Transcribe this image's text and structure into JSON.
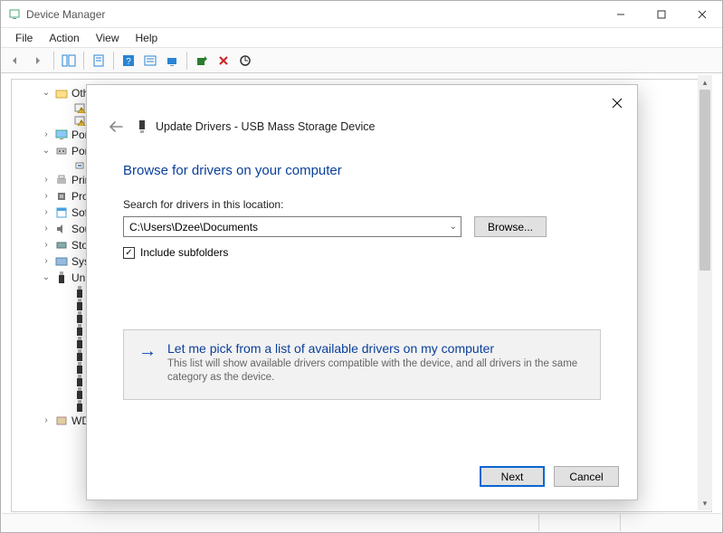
{
  "window": {
    "title": "Device Manager"
  },
  "menubar": {
    "items": [
      "File",
      "Action",
      "View",
      "Help"
    ]
  },
  "tree": {
    "items": [
      {
        "chev": "v",
        "label": "Oth",
        "indent": 1
      },
      {
        "label": "",
        "indent": 2,
        "warn": true
      },
      {
        "label": "",
        "indent": 2,
        "warn": true
      },
      {
        "chev": ">",
        "label": "Por",
        "indent": 1
      },
      {
        "chev": "v",
        "label": "Por",
        "indent": 1
      },
      {
        "label": "",
        "indent": 2
      },
      {
        "chev": ">",
        "label": "Prin",
        "indent": 1
      },
      {
        "chev": ">",
        "label": "Pro",
        "indent": 1
      },
      {
        "chev": ">",
        "label": "Sof",
        "indent": 1
      },
      {
        "chev": ">",
        "label": "Sou",
        "indent": 1
      },
      {
        "chev": ">",
        "label": "Sto",
        "indent": 1
      },
      {
        "chev": ">",
        "label": "Sys",
        "indent": 1
      },
      {
        "chev": "v",
        "label": "Uni",
        "indent": 1
      },
      {
        "label": "",
        "indent": 2,
        "usb": true
      },
      {
        "label": "",
        "indent": 2,
        "usb": true
      },
      {
        "label": "",
        "indent": 2,
        "usb": true
      },
      {
        "label": "",
        "indent": 2,
        "usb": true
      },
      {
        "label": "",
        "indent": 2,
        "usb": true
      },
      {
        "label": "",
        "indent": 2,
        "usb": true
      },
      {
        "label": "",
        "indent": 2,
        "usb": true
      },
      {
        "label": "",
        "indent": 2,
        "usb": true
      },
      {
        "label": "",
        "indent": 2,
        "usb": true
      },
      {
        "label": "",
        "indent": 2,
        "usb": true
      },
      {
        "chev": ">",
        "label": "WD",
        "indent": 1
      }
    ]
  },
  "modal": {
    "title": "Update Drivers - USB Mass Storage Device",
    "heading": "Browse for drivers on your computer",
    "search_label": "Search for drivers in this location:",
    "path": "C:\\Users\\Dzee\\Documents",
    "browse_label": "Browse...",
    "include_subfolders_label": "Include subfolders",
    "include_subfolders_checked": true,
    "link_title": "Let me pick from a list of available drivers on my computer",
    "link_desc": "This list will show available drivers compatible with the device, and all drivers in the same category as the device.",
    "next_label": "Next",
    "cancel_label": "Cancel"
  }
}
